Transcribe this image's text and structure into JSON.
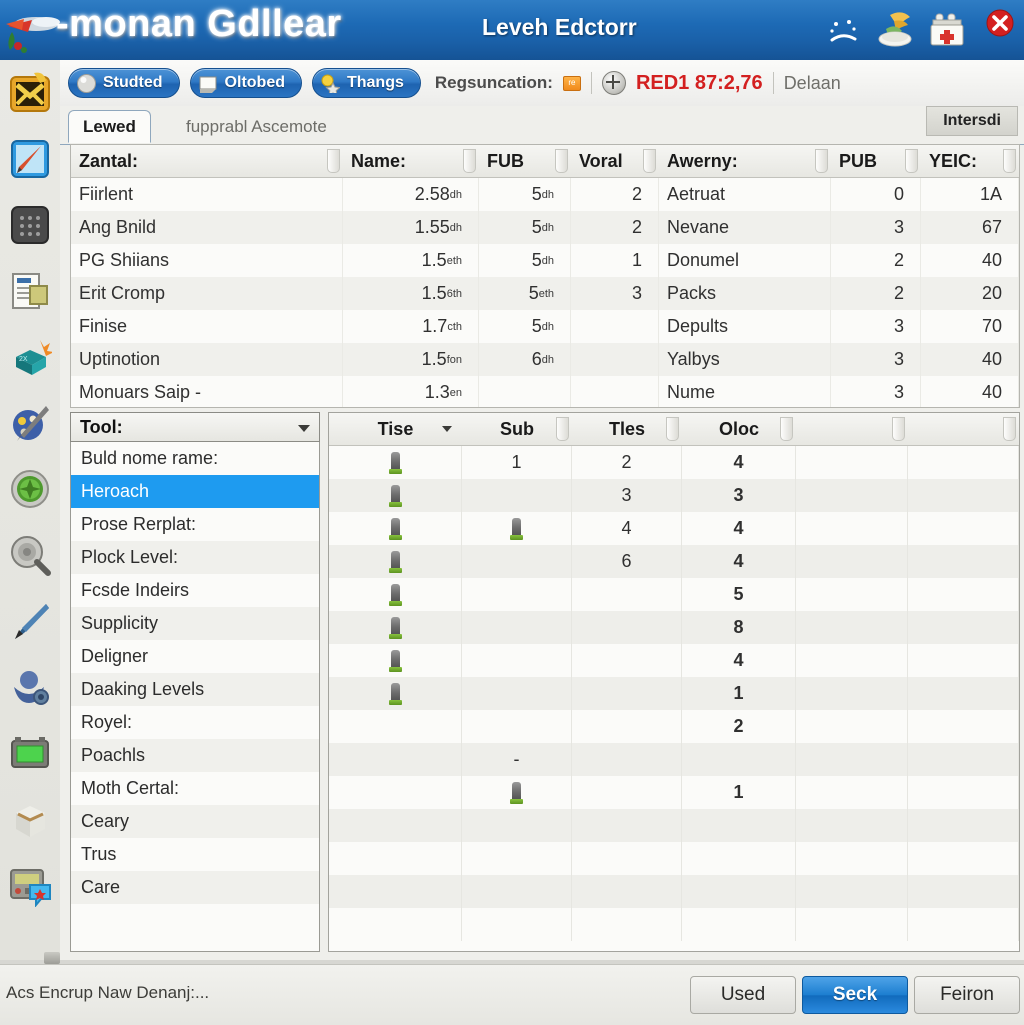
{
  "window": {
    "title": "-monan Gdllear",
    "subtitle": "Leveh Edctorr",
    "logo_icon": "parrot-logo-icon",
    "title_icons": [
      {
        "name": "sad-face-icon"
      },
      {
        "name": "bird-bowl-icon"
      },
      {
        "name": "first-aid-kit-icon"
      },
      {
        "name": "close-icon"
      }
    ]
  },
  "sidebar": {
    "items": [
      {
        "name": "sidebar-item-mail",
        "icon": "yellow-envelope-icon"
      },
      {
        "name": "sidebar-item-pen-tablet",
        "icon": "blue-pen-tablet-icon"
      },
      {
        "name": "sidebar-item-keypad",
        "icon": "dark-keypad-icon"
      },
      {
        "name": "sidebar-item-document",
        "icon": "document-list-icon"
      },
      {
        "name": "sidebar-item-teal-box",
        "icon": "teal-box-burst-icon"
      },
      {
        "name": "sidebar-item-palette",
        "icon": "palette-pencil-icon"
      },
      {
        "name": "sidebar-item-green-dial",
        "icon": "green-dial-icon"
      },
      {
        "name": "sidebar-item-magnifier",
        "icon": "metal-magnifier-icon"
      },
      {
        "name": "sidebar-item-pen",
        "icon": "blue-fountain-pen-icon"
      },
      {
        "name": "sidebar-item-engine",
        "icon": "blue-engine-icon"
      },
      {
        "name": "sidebar-item-green-screen",
        "icon": "green-screen-icon"
      },
      {
        "name": "sidebar-item-crate",
        "icon": "white-crate-icon"
      },
      {
        "name": "sidebar-item-chat-device",
        "icon": "device-chat-bubble-icon"
      }
    ]
  },
  "toolbar": {
    "pills": [
      {
        "label": "Studted",
        "icon": "grey-sphere-icon"
      },
      {
        "label": "Oltobed",
        "icon": "white-card-icon"
      },
      {
        "label": "Thangs",
        "icon": "yellow-star-icon"
      }
    ],
    "reg_label": "Regsuncation:",
    "badge": "re",
    "crosshair_icon": "crosshair-icon",
    "red_value": "RED1 87:2,76",
    "grey_value": "Delaan"
  },
  "tabs": {
    "active": "Lewed",
    "inactive": "fupprabl Ascemote",
    "side_button": "Intersdi"
  },
  "top_table": {
    "columns": [
      "Zantal:",
      "Name:",
      "FUB",
      "Voral",
      "Awerny:",
      "PUB",
      "YEIC:"
    ],
    "rows": [
      {
        "zantal": "Fiirlent",
        "name": "2.58",
        "name_sup": "dh",
        "fub": "5",
        "fub_sup": "dh",
        "voral": "2",
        "awerny": "Aetruat",
        "pub": "0",
        "yeic": "1A"
      },
      {
        "zantal": "Ang Bnild",
        "name": "1.55",
        "name_sup": "dh",
        "fub": "5",
        "fub_sup": "dh",
        "voral": "2",
        "awerny": "Nevane",
        "pub": "3",
        "yeic": "67"
      },
      {
        "zantal": "PG Shiians",
        "name": "1.5",
        "name_sup": "eth",
        "fub": "5",
        "fub_sup": "dh",
        "voral": "1",
        "awerny": "Donumel",
        "pub": "2",
        "yeic": "40"
      },
      {
        "zantal": "Erit Cromp",
        "name": "1.5",
        "name_sup": "6th",
        "fub": "5",
        "fub_sup": "eth",
        "voral": "3",
        "awerny": "Packs",
        "pub": "2",
        "yeic": "20"
      },
      {
        "zantal": "Finise",
        "name": "1.7",
        "name_sup": "cth",
        "fub": "5",
        "fub_sup": "dh",
        "voral": "",
        "awerny": "Depults",
        "pub": "3",
        "yeic": "70"
      },
      {
        "zantal": "Uptinotion",
        "name": "1.5",
        "name_sup": "fon",
        "fub": "6",
        "fub_sup": "dh",
        "voral": "",
        "awerny": "Yalbys",
        "pub": "3",
        "yeic": "40"
      },
      {
        "zantal": "Monuars Saip -",
        "name": "1.3",
        "name_sup": "en",
        "fub": "",
        "fub_sup": "",
        "voral": "",
        "awerny": "Nume",
        "pub": "3",
        "yeic": "40"
      }
    ]
  },
  "list_panel": {
    "combo_label": "Tool:",
    "items": [
      {
        "label": "Buld nome rame:",
        "selected": false
      },
      {
        "label": "Heroach",
        "selected": true
      },
      {
        "label": "Prose Rerplat:",
        "selected": false
      },
      {
        "label": "Plock Level:",
        "selected": false
      },
      {
        "label": "Fcsde Indeirs",
        "selected": false
      },
      {
        "label": "Supplicity",
        "selected": false
      },
      {
        "label": "Deligner",
        "selected": false
      },
      {
        "label": "Daaking Levels",
        "selected": false
      },
      {
        "label": "Royel:",
        "selected": false
      },
      {
        "label": "Poachls",
        "selected": false
      },
      {
        "label": "Moth Certal:",
        "selected": false
      },
      {
        "label": "Ceary",
        "selected": false
      },
      {
        "label": "Trus",
        "selected": false
      },
      {
        "label": "Care",
        "selected": false
      }
    ]
  },
  "grid_panel": {
    "columns": [
      "Tise",
      "Sub",
      "Tles",
      "Oloc",
      "",
      ""
    ],
    "rows": [
      {
        "tise": "tower-icon",
        "sub": "1",
        "tles": "2",
        "oloc": "4"
      },
      {
        "tise": "tower-icon",
        "sub": "",
        "tles": "3",
        "oloc": "3"
      },
      {
        "tise": "tower-icon",
        "sub": "tower-icon",
        "tles": "4",
        "oloc": "4"
      },
      {
        "tise": "tower-icon",
        "sub": "",
        "tles": "6",
        "oloc": "4"
      },
      {
        "tise": "tower-icon",
        "sub": "",
        "tles": "",
        "oloc": "5"
      },
      {
        "tise": "tower-icon",
        "sub": "",
        "tles": "",
        "oloc": "8"
      },
      {
        "tise": "tower-icon",
        "sub": "",
        "tles": "",
        "oloc": "4"
      },
      {
        "tise": "tower-icon",
        "sub": "",
        "tles": "",
        "oloc": "1"
      },
      {
        "tise": "",
        "sub": "",
        "tles": "",
        "oloc": "2"
      },
      {
        "tise": "",
        "sub": "-",
        "tles": "",
        "oloc": ""
      },
      {
        "tise": "",
        "sub": "tower-icon",
        "tles": "",
        "oloc": "1"
      },
      {
        "tise": "",
        "sub": "",
        "tles": "",
        "oloc": ""
      },
      {
        "tise": "",
        "sub": "",
        "tles": "",
        "oloc": ""
      },
      {
        "tise": "",
        "sub": "",
        "tles": "",
        "oloc": ""
      },
      {
        "tise": "",
        "sub": "",
        "tles": "",
        "oloc": ""
      }
    ]
  },
  "statusbar": {
    "message": "Acs Encrup Naw Denanj:...",
    "buttons": [
      {
        "label": "Used",
        "primary": false
      },
      {
        "label": "Seck",
        "primary": true
      },
      {
        "label": "Feiron",
        "primary": false
      }
    ]
  },
  "colors": {
    "title_bar": "#1d6ab5",
    "accent_blue": "#1e9bf0",
    "alert_red": "#d32020",
    "panel_bg": "#fbfbf9"
  }
}
